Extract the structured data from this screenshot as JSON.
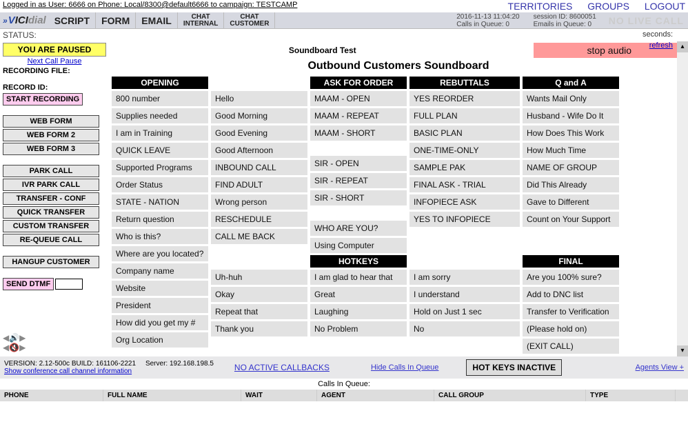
{
  "login": {
    "text": "Logged in as User: 6666 on Phone: Local/8300@default6666 to campaign: TESTCAMP",
    "territories": "TERRITORIES",
    "groups": "GROUPS",
    "logout": "LOGOUT"
  },
  "tabs": {
    "script": "SCRIPT",
    "form": "FORM",
    "email": "EMAIL",
    "chat_internal": "CHAT INTERNAL",
    "chat_customer": "CHAT CUSTOMER"
  },
  "header": {
    "timestamp": "2016-11-13 11:04:20",
    "calls_in_queue": "Calls in Queue: 0",
    "session_id": "session ID: 8600051",
    "emails_in_queue": "Emails in Queue: 0",
    "no_live_call": "NO LIVE CALL"
  },
  "status": {
    "label": "STATUS:",
    "seconds": "seconds:"
  },
  "left": {
    "paused": "YOU ARE PAUSED",
    "next_call_pause": "Next Call Pause",
    "recording_file": "RECORDING FILE:",
    "record_id": "RECORD ID:",
    "start_recording": "START RECORDING",
    "web_form": "WEB FORM",
    "web_form_2": "WEB FORM 2",
    "web_form_3": "WEB FORM 3",
    "park_call": "PARK CALL",
    "ivr_park_call": "IVR PARK CALL",
    "transfer_conf": "TRANSFER - CONF",
    "quick_transfer": "QUICK TRANSFER",
    "custom_transfer": "CUSTOM TRANSFER",
    "requeue_call": "RE-QUEUE CALL",
    "hangup": "HANGUP CUSTOMER",
    "send_dtmf": "SEND DTMF"
  },
  "soundboard": {
    "small_title": "Soundboard Test",
    "heading": "Outbound Customers Soundboard",
    "stop": "stop audio",
    "refresh": "refresh",
    "columns": {
      "opening_hdr": "OPENING",
      "opening": [
        "Hello",
        "Good Morning",
        "Good Evening",
        "Good Afternoon",
        "INBOUND CALL",
        "FIND ADULT",
        "Wrong person",
        "RESCHEDULE",
        "CALL ME BACK"
      ],
      "col2a": [
        "MAAM - OPEN",
        "MAAM - REPEAT",
        "MAAM - SHORT"
      ],
      "col2b": [
        "SIR - OPEN",
        "SIR - REPEAT",
        "SIR - SHORT"
      ],
      "col2c": [
        "WHO ARE YOU?",
        "Using Computer"
      ],
      "ask_hdr": "ASK FOR ORDER",
      "ask": [
        "YES REORDER",
        "FULL PLAN",
        "BASIC PLAN",
        "ONE-TIME-ONLY",
        "SAMPLE PAK",
        "FINAL ASK - TRIAL",
        "INFOPIECE ASK",
        "YES TO INFOPIECE"
      ],
      "reb_hdr": "REBUTTALS",
      "reb": [
        "Wants Mail Only",
        "Husband - Wife Do It",
        "How Does This Work",
        "How Much Time",
        "NAME OF GROUP",
        "Did This Already",
        "Gave to Different",
        "Count on Your Support"
      ],
      "qa_hdr": "Q and A",
      "qa": [
        "800 number",
        "Supplies needed",
        "I am in Training",
        "QUICK LEAVE",
        "Supported Programs",
        "Order Status",
        "STATE - NATION",
        "Return question",
        "Who is this?",
        "Where are you located?",
        "Company name",
        "Website",
        "President",
        "How did you get my #",
        "Org Location"
      ],
      "hot_hdr": "HOTKEYS",
      "hot1": [
        "Uh-huh",
        "Okay",
        "Repeat that",
        "Thank you"
      ],
      "hot2": [
        "I am glad to hear that",
        "Great",
        "Laughing",
        "No Problem"
      ],
      "hot3": [
        "I am sorry",
        "I understand",
        "Hold on Just 1 sec",
        "No"
      ],
      "final_hdr": "FINAL",
      "final": [
        "Are you 100% sure?",
        "Add to DNC list",
        "Transfer to Verification",
        "(Please hold on)",
        "(EXIT CALL)"
      ]
    }
  },
  "bottom": {
    "version": "VERSION: 2.12-500c   BUILD: 161106-2221",
    "server": "Server: 192.168.198.5",
    "conf_link": "Show conference call channel information",
    "no_active_callbacks": "NO ACTIVE CALLBACKS",
    "hide_calls": "Hide Calls In Queue",
    "hotkeys_inactive": "HOT KEYS INACTIVE",
    "agents_view": "Agents View +",
    "ciq": "Calls In Queue:",
    "cols": {
      "phone": "PHONE",
      "full_name": "FULL NAME",
      "wait": "WAIT",
      "agent": "AGENT",
      "call_group": "CALL GROUP",
      "type": "TYPE"
    }
  }
}
